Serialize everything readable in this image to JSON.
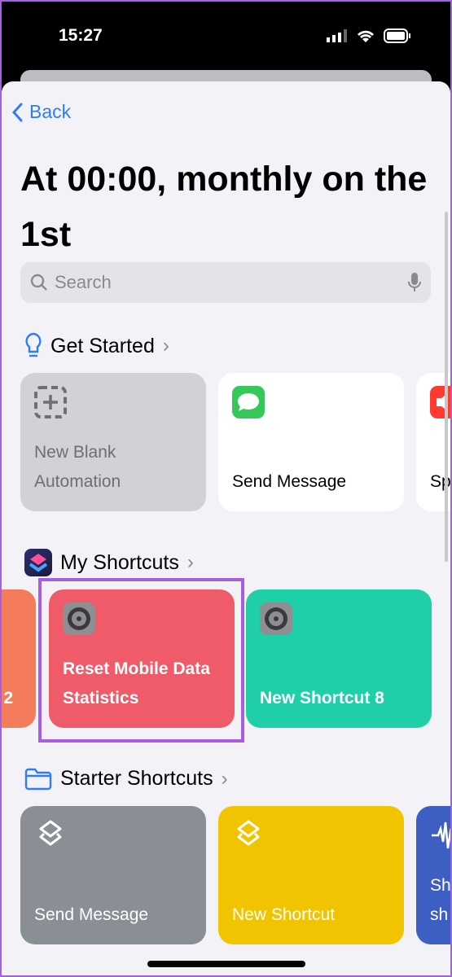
{
  "status": {
    "time": "15:27"
  },
  "nav": {
    "back": "Back"
  },
  "title": "At 00:00, monthly on the 1st",
  "search": {
    "placeholder": "Search"
  },
  "get_started": {
    "title": "Get Started",
    "cards": [
      {
        "label": "New Blank Automation",
        "icon": "dashed-plus-icon",
        "color": "#d1d1d6"
      },
      {
        "label": "Send Message",
        "icon": "messages-icon",
        "color": "#ffffff"
      },
      {
        "label": "Sp",
        "icon": "speaker-icon",
        "color": "#ffffff"
      }
    ]
  },
  "my_shortcuts": {
    "title": "My Shortcuts",
    "cards": [
      {
        "label": "2",
        "color": "#f47c5a"
      },
      {
        "label": "Reset Mobile Data Statistics",
        "icon": "settings-icon",
        "color": "#ef5b68",
        "selected": true
      },
      {
        "label": "New Shortcut 8",
        "icon": "settings-icon",
        "color": "#1ecfa8"
      }
    ]
  },
  "starter_shortcuts": {
    "title": "Starter Shortcuts",
    "cards": [
      {
        "label": "Send Message",
        "icon": "layers-icon",
        "color": "#8a8f96"
      },
      {
        "label": "New Shortcut",
        "icon": "layers-icon",
        "color": "#f0c400"
      },
      {
        "label": "Sh sh",
        "icon": "waveform-icon",
        "color": "#3d5fc4"
      }
    ]
  },
  "colors": {
    "accent": "#2f7cf6",
    "highlight": "#a65fe0"
  }
}
